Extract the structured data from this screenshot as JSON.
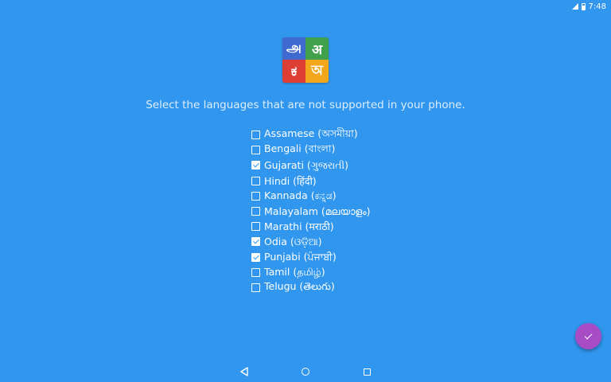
{
  "status_bar": {
    "time": "7:48",
    "signal_icon": "signal-icon",
    "battery_icon": "battery-icon"
  },
  "logo": {
    "cells": [
      {
        "glyph": "அ",
        "color": "#3f6bd1"
      },
      {
        "glyph": "अ",
        "color": "#3fa14b"
      },
      {
        "glyph": "ಕ",
        "color": "#de3f35"
      },
      {
        "glyph": "অ",
        "color": "#f2a71b"
      }
    ]
  },
  "prompt": "Select the languages that are not supported in your phone.",
  "languages": [
    {
      "label": "Assamese (অসমীয়া)",
      "checked": false
    },
    {
      "label": "Bengali (বাংলা)",
      "checked": false
    },
    {
      "label": "Gujarati (ગુજરાતી)",
      "checked": true
    },
    {
      "label": "Hindi (हिंदी)",
      "checked": false
    },
    {
      "label": "Kannada (ಕನ್ನಡ)",
      "checked": false
    },
    {
      "label": "Malayalam (മലയാളം)",
      "checked": false
    },
    {
      "label": "Marathi (मराठी)",
      "checked": false
    },
    {
      "label": "Odia (ଓଡ଼ିଆ)",
      "checked": true
    },
    {
      "label": "Punjabi (ਪੰਜਾਬੀ)",
      "checked": true
    },
    {
      "label": "Tamil (தமிழ்)",
      "checked": false
    },
    {
      "label": "Telugu (తెలుగు)",
      "checked": false
    }
  ],
  "fab": {
    "icon": "check-icon",
    "color": "#a84cc6"
  },
  "nav": {
    "back_icon": "back-triangle-icon",
    "home_icon": "home-circle-icon",
    "recent_icon": "recent-square-icon"
  },
  "colors": {
    "background": "#3096ee",
    "text": "#ffffff"
  }
}
